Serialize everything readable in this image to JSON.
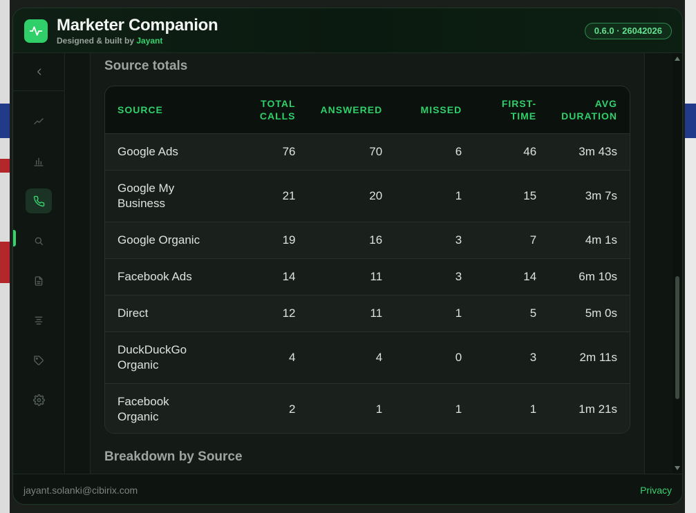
{
  "colors": {
    "accent": "#2fd06a",
    "background": "#0d130f",
    "panel": "#1a201c"
  },
  "app": {
    "title": "Marketer Companion",
    "subtitle_prefix": "Designed & built by",
    "author": "Jayant",
    "version": "0.6.0 · 26042026",
    "logo_icon": "activity-pulse-icon"
  },
  "sidebar": {
    "collapse_icon": "chevron-left-icon",
    "items": [
      {
        "icon": "trend-line-icon",
        "active": false
      },
      {
        "icon": "bar-chart-icon",
        "active": false
      },
      {
        "icon": "phone-icon",
        "active": true
      },
      {
        "icon": "search-icon",
        "active": false
      },
      {
        "icon": "document-icon",
        "active": false
      },
      {
        "icon": "align-center-icon",
        "active": false
      },
      {
        "icon": "tag-icon",
        "active": false
      },
      {
        "icon": "gear-icon",
        "active": false
      }
    ]
  },
  "main": {
    "section1_title": "Source totals",
    "section2_title": "Breakdown by Source",
    "table": {
      "columns": [
        {
          "key": "source",
          "label": "SOURCE",
          "label2": ""
        },
        {
          "key": "total",
          "label": "TOTAL",
          "label2": "CALLS"
        },
        {
          "key": "answered",
          "label": "ANSWERED",
          "label2": ""
        },
        {
          "key": "missed",
          "label": "MISSED",
          "label2": ""
        },
        {
          "key": "first",
          "label": "FIRST-",
          "label2": "TIME"
        },
        {
          "key": "avg",
          "label": "AVG",
          "label2": "DURATION"
        }
      ],
      "rows": [
        {
          "source": "Google Ads",
          "source2": "",
          "total": "76",
          "answered": "70",
          "missed": "6",
          "first": "46",
          "avg": "3m 43s"
        },
        {
          "source": "Google My",
          "source2": "Business",
          "total": "21",
          "answered": "20",
          "missed": "1",
          "first": "15",
          "avg": "3m 7s"
        },
        {
          "source": "Google Organic",
          "source2": "",
          "total": "19",
          "answered": "16",
          "missed": "3",
          "first": "7",
          "avg": "4m 1s"
        },
        {
          "source": "Facebook Ads",
          "source2": "",
          "total": "14",
          "answered": "11",
          "missed": "3",
          "first": "14",
          "avg": "6m 10s"
        },
        {
          "source": "Direct",
          "source2": "",
          "total": "12",
          "answered": "11",
          "missed": "1",
          "first": "5",
          "avg": "5m 0s"
        },
        {
          "source": "DuckDuckGo",
          "source2": "Organic",
          "total": "4",
          "answered": "4",
          "missed": "0",
          "first": "3",
          "avg": "2m 11s"
        },
        {
          "source": "Facebook",
          "source2": "Organic",
          "total": "2",
          "answered": "1",
          "missed": "1",
          "first": "1",
          "avg": "1m 21s"
        }
      ]
    }
  },
  "footer": {
    "email": "jayant.solanki@cibirix.com",
    "privacy": "Privacy"
  }
}
